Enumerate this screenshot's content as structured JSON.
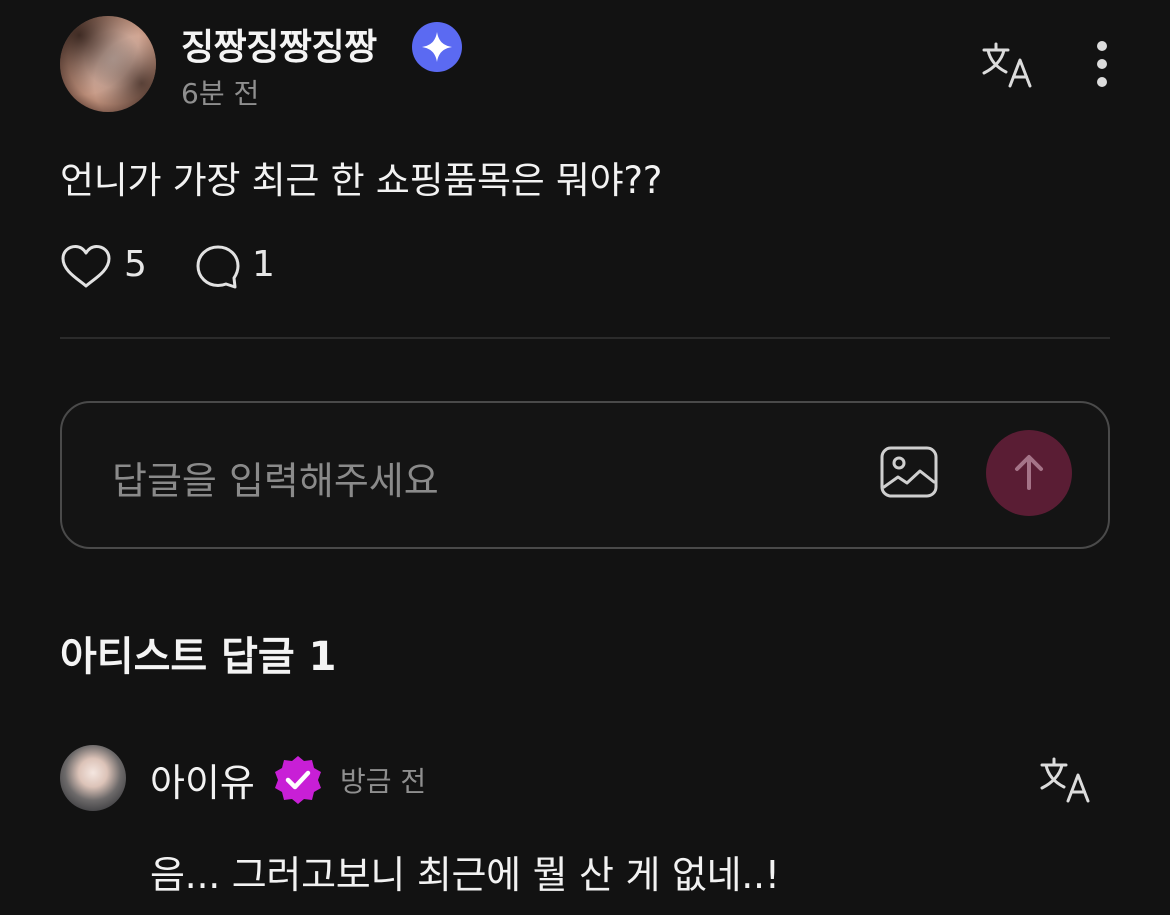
{
  "post": {
    "author": "징짱징짱징짱",
    "author_badge_icon": "sparkle-badge-icon",
    "time": "6분 전",
    "text": "언니가 가장 최근 한 쇼핑품목은 뭐야??",
    "likes": "5",
    "comments": "1"
  },
  "reply_input": {
    "placeholder": "답글을 입력해주세요",
    "send_color": "#5a1d34"
  },
  "artist_section": {
    "title": "아티스트 답글 1"
  },
  "artist_reply": {
    "name": "아이유",
    "badge_icon": "verified-badge-icon",
    "time": "방금 전",
    "text": "음... 그러고보니 최근에 뭘 산 게 없네..!"
  },
  "colors": {
    "background": "#121212",
    "star_badge": "#5b6af2",
    "verified_badge": "#c81fd6"
  }
}
